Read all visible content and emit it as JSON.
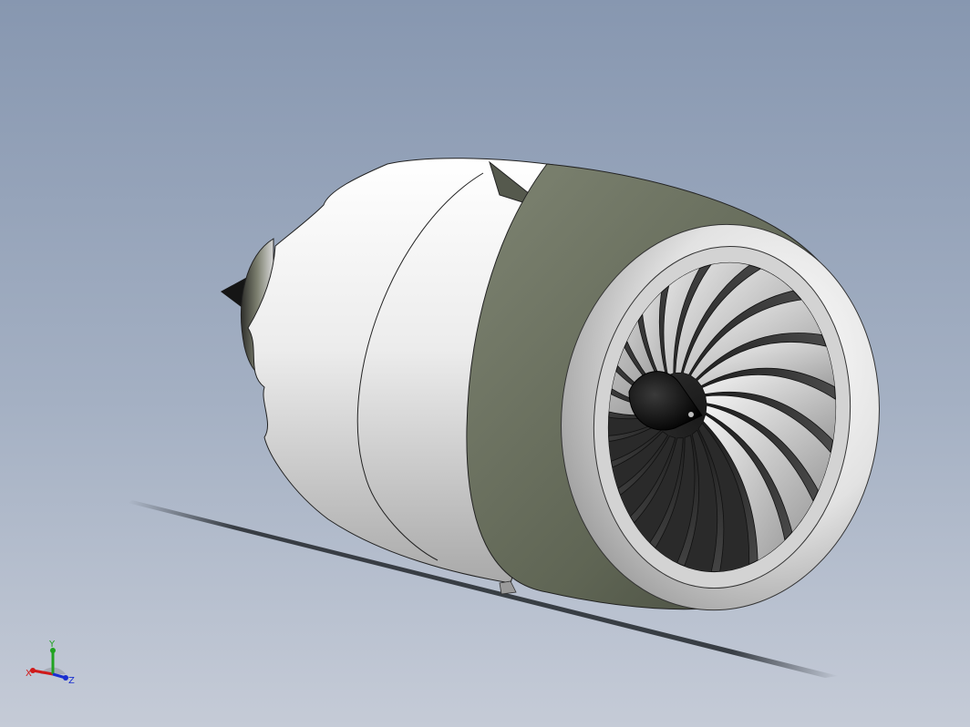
{
  "viewport": {
    "background_top": "#8797b0",
    "background_bottom": "#c5cbd7"
  },
  "model": {
    "nacelle_body_color": "#e6e6e6",
    "nacelle_band_color": "#6e7463",
    "inlet_lip_color": "#d9d9d9",
    "fan_blade_color": "#cfcfcf",
    "spinner_color": "#111111",
    "fan_blade_count": 22
  },
  "triad": {
    "x_label": "X",
    "y_label": "Y",
    "z_label": "Z",
    "x_color": "#d01a1a",
    "y_color": "#21a321",
    "z_color": "#1a2fd0"
  }
}
